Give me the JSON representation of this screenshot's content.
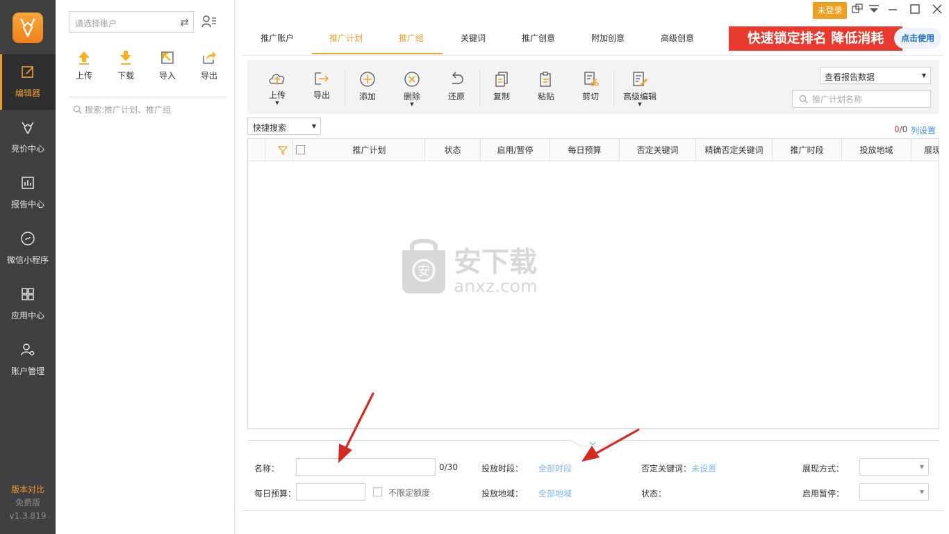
{
  "nav": {
    "items": [
      {
        "label": "编辑器"
      },
      {
        "label": "竞价中心"
      },
      {
        "label": "报告中心"
      },
      {
        "label": "微信小程序"
      },
      {
        "label": "应用中心"
      },
      {
        "label": "账户管理"
      }
    ],
    "compare": "版本对比",
    "edition": "免费版",
    "version": "v1.3.819"
  },
  "tree": {
    "account_placeholder": "请选择账户",
    "tools": [
      "上传",
      "下载",
      "导入",
      "导出"
    ],
    "search_placeholder": "搜索:推广计划、推广组"
  },
  "titlebar": {
    "login_status": "未登录"
  },
  "tabs": [
    "推广账户",
    "推广计划",
    "推广组",
    "关键词",
    "推广创意",
    "附加创意",
    "高级创意"
  ],
  "banner": {
    "text": "快速锁定排名 降低消耗",
    "cta": "点击使用"
  },
  "toolbar": {
    "buttons": [
      "上传",
      "导出",
      "添加",
      "删除",
      "还原",
      "复制",
      "粘贴",
      "剪切",
      "高级编辑"
    ],
    "report_select": "查看报告数据",
    "plan_search_placeholder": "推广计划名称"
  },
  "list": {
    "quick_search": "快捷搜索",
    "count_selected": "0",
    "count_total": "/0",
    "column_settings": "列设置",
    "columns": [
      "推广计划",
      "状态",
      "启用/暂停",
      "每日预算",
      "否定关键词",
      "精确否定关键词",
      "推广时段",
      "投放地域",
      "展现"
    ]
  },
  "watermark": {
    "brand": "安下载",
    "domain": "anxz.com",
    "badge": "安"
  },
  "detail": {
    "name_label": "名称：",
    "name_counter": "0/30",
    "budget_label": "每日预算：",
    "unlimited_label": "不限定额度",
    "schedule_label": "投放时段：",
    "schedule_value": "全部时段",
    "region_label": "投放地域：",
    "region_value": "全部地域",
    "negative_label": "否定关键词：",
    "negative_value": "未设置",
    "status_label": "状态：",
    "display_label": "展现方式：",
    "pause_label": "启用暂停："
  },
  "colors": {
    "accent": "#f0a030",
    "nav_bg": "#3f3f41",
    "banner_red": "#e8392d",
    "link_blue": "#3a8ee6",
    "annotation_arrow": "#d42a22"
  }
}
